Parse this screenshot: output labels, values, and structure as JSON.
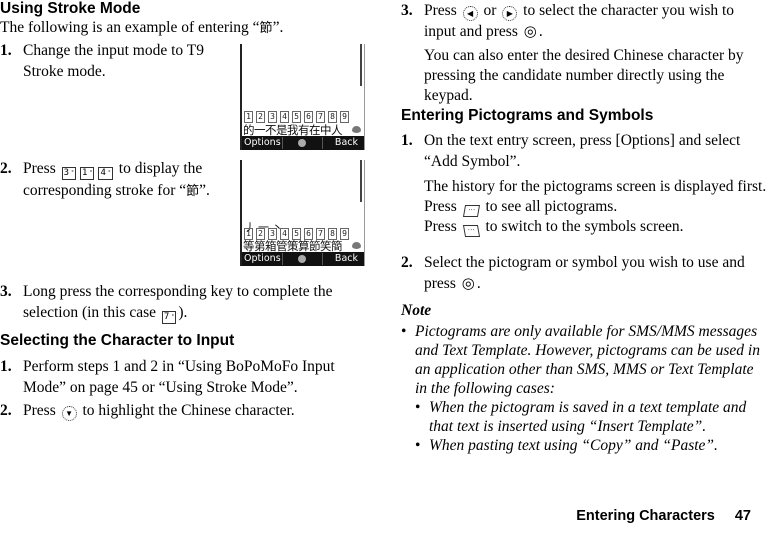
{
  "left_column": {
    "section1": {
      "heading": "Using Stroke Mode",
      "intro_prefix": "The following is an example of entering “",
      "intro_char": "節",
      "intro_suffix": "”.",
      "steps": [
        {
          "num": "1.",
          "text": "Change the input mode to T9 Stroke mode."
        },
        {
          "num": "2.",
          "text_prefix": "Press",
          "keys": [
            "3",
            "1",
            "4"
          ],
          "text_suffix": "to display the corresponding stroke for",
          "char_quote_open": "“",
          "char": "節",
          "char_quote_close": "”."
        },
        {
          "num": "3.",
          "text_prefix": "Long press the corresponding key to complete the selection (in this case",
          "key": "7",
          "text_suffix": ")."
        }
      ]
    },
    "section2": {
      "heading": "Selecting the Character to Input",
      "steps": [
        {
          "num": "1.",
          "text": "Perform steps 1 and 2 in “Using BoPoMoFo Input Mode” on page 45 or “Using Stroke Mode”."
        },
        {
          "num": "2.",
          "text_prefix": "Press",
          "nav_icon": "▼",
          "text_suffix": "to highlight the Chinese character."
        }
      ]
    }
  },
  "phone_screens": [
    {
      "strokes": "",
      "numbers": [
        "1",
        "2",
        "3",
        "4",
        "5",
        "6",
        "7",
        "8",
        "9"
      ],
      "candidates": "的一不是我有在中人",
      "softkey_left": "Options",
      "softkey_right": "Back"
    },
    {
      "strokes": "丿一丶",
      "numbers": [
        "1",
        "2",
        "3",
        "4",
        "5",
        "6",
        "7",
        "8",
        "9"
      ],
      "candidates": "等第箱管策算節笑簡",
      "softkey_left": "Options",
      "softkey_right": "Back"
    }
  ],
  "right_column": {
    "step3": {
      "num": "3.",
      "text_a": "Press",
      "left_icon": "◀",
      "or": "or",
      "right_icon": "▶",
      "text_b": "to select the character you wish to input and press",
      "center_icon": "◎",
      "text_c": ".",
      "extra": "You can also enter the desired Chinese character by pressing the candidate number directly using the keypad."
    },
    "section3": {
      "heading": "Entering Pictograms and Symbols",
      "steps": [
        {
          "num": "1.",
          "text": "On the text entry screen, press [Options] and select “Add Symbol”.",
          "extra1": "The history for the pictograms screen is displayed first.",
          "extra2_prefix": "Press",
          "extra2_suffix": "to see all pictograms.",
          "extra3_prefix": "Press",
          "extra3_suffix": "to switch to the symbols screen."
        },
        {
          "num": "2.",
          "text_prefix": "Select the pictogram or symbol you wish to use and press",
          "center_icon": "◎",
          "text_suffix": "."
        }
      ]
    },
    "note": {
      "title": "Note",
      "bullet": "Pictograms are only available for SMS/MMS messages and Text Template. However, pictograms can be used in an application other than SMS, MMS or Text Template in the following cases:",
      "sub_bullets": [
        "When the pictogram is saved in a text template and that text is inserted using “Insert Template”.",
        "When pasting text using “Copy” and “Paste”."
      ]
    }
  },
  "footer": {
    "section": "Entering Characters",
    "page": "47"
  }
}
